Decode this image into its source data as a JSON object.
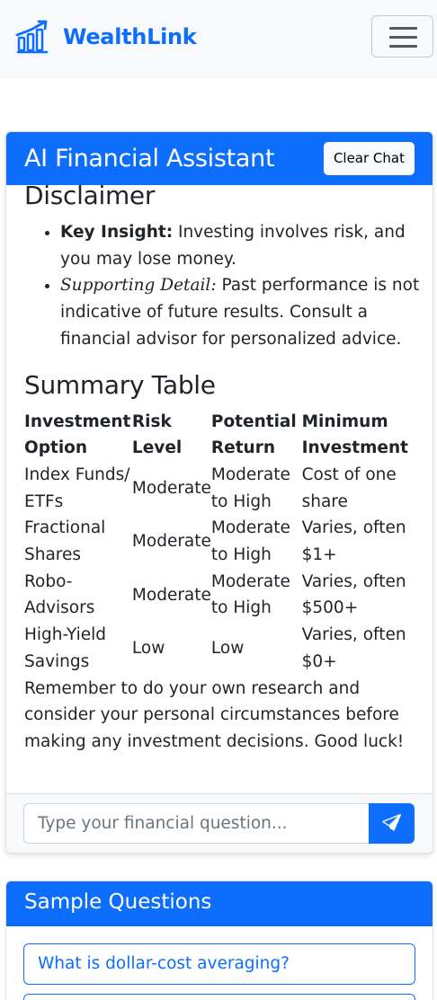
{
  "nav": {
    "brand": "WealthLink"
  },
  "chat": {
    "title": "AI Financial Assistant",
    "clear_label": "Clear Chat",
    "message": {
      "disclaimer_heading": "Disclaimer",
      "bullets": [
        {
          "lead": "Key Insight:",
          "text": " Investing involves risk, and you may lose money."
        },
        {
          "lead": "Supporting Detail:",
          "text": " Past performance is not indicative of future results. Consult a financial advisor for personalized advice."
        }
      ],
      "table_heading": "Summary Table",
      "table": {
        "headers": [
          "Investment Option",
          "Risk Level",
          "Potential Return",
          "Minimum Investment"
        ],
        "rows": [
          [
            "Index Funds/ ETFs",
            "Moderate",
            "Moderate to High",
            "Cost of one share"
          ],
          [
            "Fractional Shares",
            "Moderate",
            "Moderate to High",
            "Varies, often $1+"
          ],
          [
            "Robo-Advisors",
            "Moderate",
            "Moderate to High",
            "Varies, often $500+"
          ],
          [
            "High-Yield Savings",
            "Low",
            "Low",
            "Varies, often $0+"
          ]
        ]
      },
      "closing": "Remember to do your own research and consider your personal circumstances before making any investment decisions. Good luck!"
    },
    "input_placeholder": "Type your financial question..."
  },
  "samples": {
    "title": "Sample Questions",
    "questions": [
      "What is dollar-cost averaging?",
      ""
    ]
  },
  "colors": {
    "primary": "#0d6efd",
    "navbar_bg": "#f8f9fa"
  }
}
